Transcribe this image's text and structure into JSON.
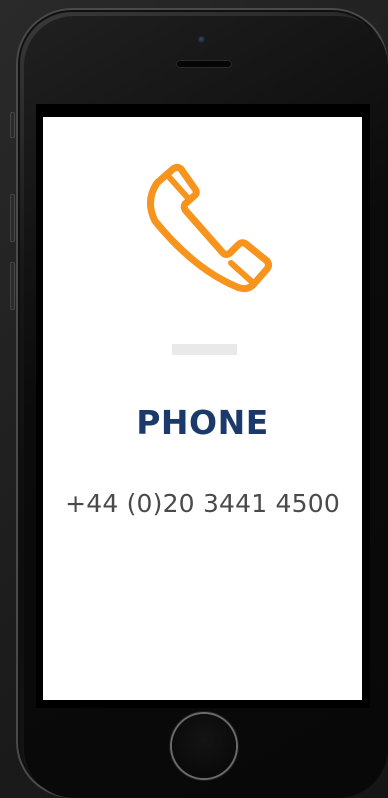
{
  "contact": {
    "heading": "PHONE",
    "number": "+44 (0)20 3441 4500"
  },
  "icons": {
    "main": "phone-handset-icon"
  },
  "colors": {
    "accent": "#f7941d",
    "heading": "#1b3a6b",
    "text": "#4a4a4a"
  }
}
